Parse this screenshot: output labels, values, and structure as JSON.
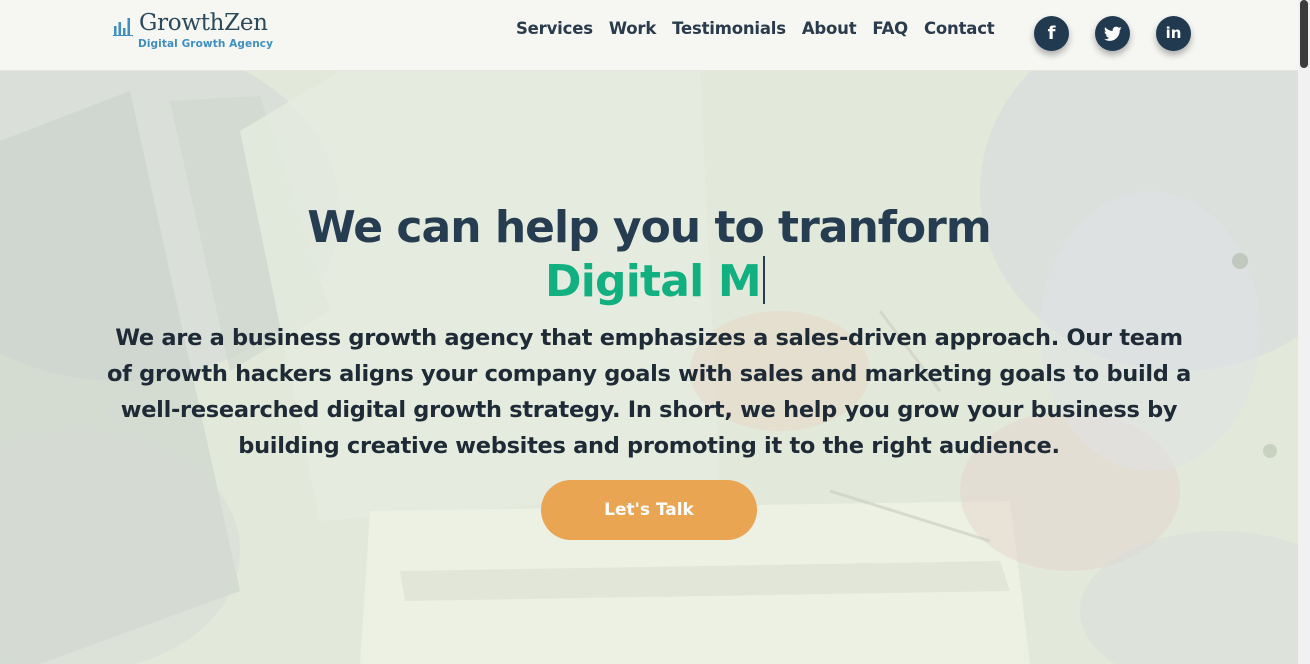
{
  "header": {
    "logo": {
      "name": "GrowthZen",
      "tagline": "Digital Growth Agency",
      "icon": "bar-chart-icon"
    },
    "nav": [
      {
        "label": "Services"
      },
      {
        "label": "Work"
      },
      {
        "label": "Testimonials"
      },
      {
        "label": "About"
      },
      {
        "label": "FAQ"
      },
      {
        "label": "Contact"
      }
    ],
    "social": [
      {
        "icon": "facebook-icon",
        "glyph": "f"
      },
      {
        "icon": "twitter-icon"
      },
      {
        "icon": "linkedin-icon",
        "glyph": "in"
      }
    ]
  },
  "hero": {
    "title": "We can help you to tranform",
    "typed_text": "Digital M",
    "description": "We are a business growth agency that emphasizes a sales-driven approach. Our team of growth hackers aligns your company goals with sales and marketing goals to build a well-researched digital growth strategy. In short, we help you grow your business by building creative websites and promoting it to the right audience.",
    "cta_label": "Let's Talk"
  },
  "colors": {
    "brand_dark": "#263d51",
    "accent_green": "#12b081",
    "cta_orange": "#eaa553",
    "social_bg": "#213a50",
    "tagline_blue": "#3f8fc3"
  }
}
